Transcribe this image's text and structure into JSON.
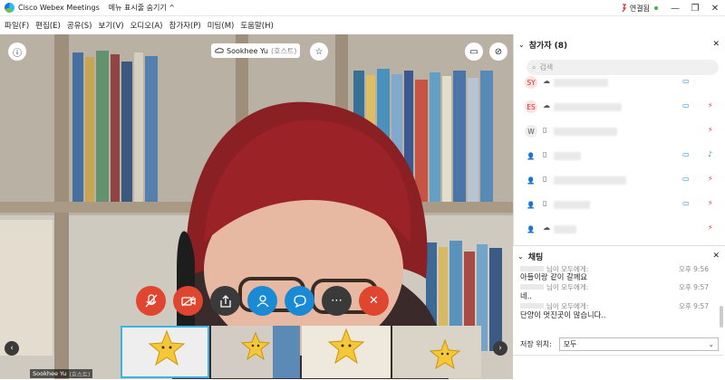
{
  "titlebar": {
    "app_title": "Cisco Webex Meetings",
    "hide_menu": "메뉴 표시줄 숨기기 ^",
    "connection": "연결됨",
    "min": "—",
    "restore": "❐",
    "close": "✕"
  },
  "menu": [
    "파일(F)",
    "편집(E)",
    "공유(S)",
    "보기(V)",
    "오디오(A)",
    "참가자(P)",
    "미팅(M)",
    "도움말(H)"
  ],
  "video": {
    "speaker_name": "Sookhee Yu",
    "speaker_role": "(호스트)"
  },
  "filmstrip": {
    "first_label_name": "Sookhee Yu",
    "first_label_role": "(호스트)"
  },
  "participants": {
    "header": "참가자 (8)",
    "search_placeholder": "검색",
    "rows": [
      {
        "initials": "SY"
      },
      {
        "initials": "ES"
      },
      {
        "initials": "W"
      },
      {
        "initials": ""
      },
      {
        "initials": ""
      },
      {
        "initials": ""
      },
      {
        "initials": ""
      },
      {
        "initials": ""
      }
    ]
  },
  "chat": {
    "header": "채팅",
    "messages": [
      {
        "meta": "님이 모두에게:",
        "time": "오후 9:56",
        "text": "아들이랑 같이 갈께요"
      },
      {
        "meta": "님이 모두에게:",
        "time": "오후 9:57",
        "text": "네.."
      },
      {
        "meta": "님이 모두에게:",
        "time": "오후 9:57",
        "text": "단양이 멋진곳이 많습니다.."
      }
    ],
    "save_label": "저장 위치:",
    "save_value": "모두"
  },
  "colors": {
    "mute": "#e0452f",
    "end": "#e0452f",
    "blue": "#1a8ad4",
    "dark": "#3a3a3a"
  }
}
